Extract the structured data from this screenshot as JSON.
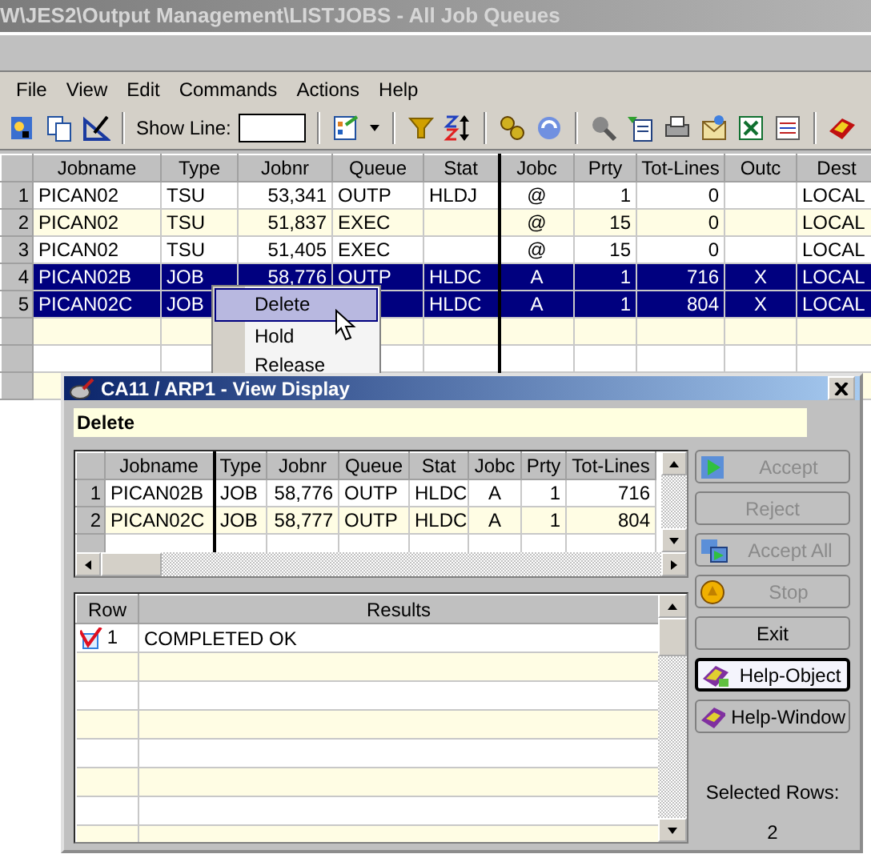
{
  "window": {
    "title": "W\\JES2\\Output Management\\LISTJOBS - All Job Queues"
  },
  "menu": [
    "File",
    "View",
    "Edit",
    "Commands",
    "Actions",
    "Help"
  ],
  "toolbar": {
    "show_line_label": "Show Line:"
  },
  "table": {
    "columns": [
      "Jobname",
      "Type",
      "Jobnr",
      "Queue",
      "Stat",
      "Jobc",
      "Prty",
      "Tot-Lines",
      "Outc",
      "Dest"
    ],
    "rows": [
      {
        "num": "1",
        "cells": [
          "PICAN02",
          "TSU",
          "53,341",
          "OUTP",
          "HLDJ",
          "@",
          "1",
          "0",
          "",
          "LOCAL"
        ],
        "selected": false
      },
      {
        "num": "2",
        "cells": [
          "PICAN02",
          "TSU",
          "51,837",
          "EXEC",
          "",
          "@",
          "15",
          "0",
          "",
          "LOCAL"
        ],
        "selected": false
      },
      {
        "num": "3",
        "cells": [
          "PICAN02",
          "TSU",
          "51,405",
          "EXEC",
          "",
          "@",
          "15",
          "0",
          "",
          "LOCAL"
        ],
        "selected": false
      },
      {
        "num": "4",
        "cells": [
          "PICAN02B",
          "JOB",
          "58,776",
          "OUTP",
          "HLDC",
          "A",
          "1",
          "716",
          "X",
          "LOCAL"
        ],
        "selected": true
      },
      {
        "num": "5",
        "cells": [
          "PICAN02C",
          "JOB",
          "",
          "",
          "HLDC",
          "A",
          "1",
          "804",
          "X",
          "LOCAL"
        ],
        "selected": true
      }
    ]
  },
  "context_menu": [
    {
      "label": "Delete",
      "selected": true
    },
    {
      "label": "Hold",
      "selected": false
    },
    {
      "label": "Release",
      "selected": false
    }
  ],
  "dialog": {
    "title": "CA11 / ARP1 - View Display",
    "action": "Delete",
    "table": {
      "columns": [
        "Jobname",
        "Type",
        "Jobnr",
        "Queue",
        "Stat",
        "Jobc",
        "Prty",
        "Tot-Lines"
      ],
      "rows": [
        {
          "num": "1",
          "cells": [
            "PICAN02B",
            "JOB",
            "58,776",
            "OUTP",
            "HLDC",
            "A",
            "1",
            "716"
          ]
        },
        {
          "num": "2",
          "cells": [
            "PICAN02C",
            "JOB",
            "58,777",
            "OUTP",
            "HLDC",
            "A",
            "1",
            "804"
          ]
        }
      ]
    },
    "results": {
      "columns": [
        "Row",
        "Results"
      ],
      "rows": [
        {
          "row": "1",
          "checked": true,
          "result": "COMPLETED OK"
        }
      ]
    },
    "buttons": [
      {
        "label": "Accept",
        "disabled": true,
        "focused": false
      },
      {
        "label": "Reject",
        "disabled": true,
        "focused": false
      },
      {
        "label": "Accept All",
        "disabled": true,
        "focused": false
      },
      {
        "label": "Stop",
        "disabled": true,
        "focused": false
      },
      {
        "label": "Exit",
        "disabled": false,
        "focused": false
      },
      {
        "label": "Help-Object",
        "disabled": false,
        "focused": true
      },
      {
        "label": "Help-Window",
        "disabled": false,
        "focused": false
      }
    ],
    "selected_rows_label": "Selected Rows:",
    "selected_rows_value": "2"
  }
}
